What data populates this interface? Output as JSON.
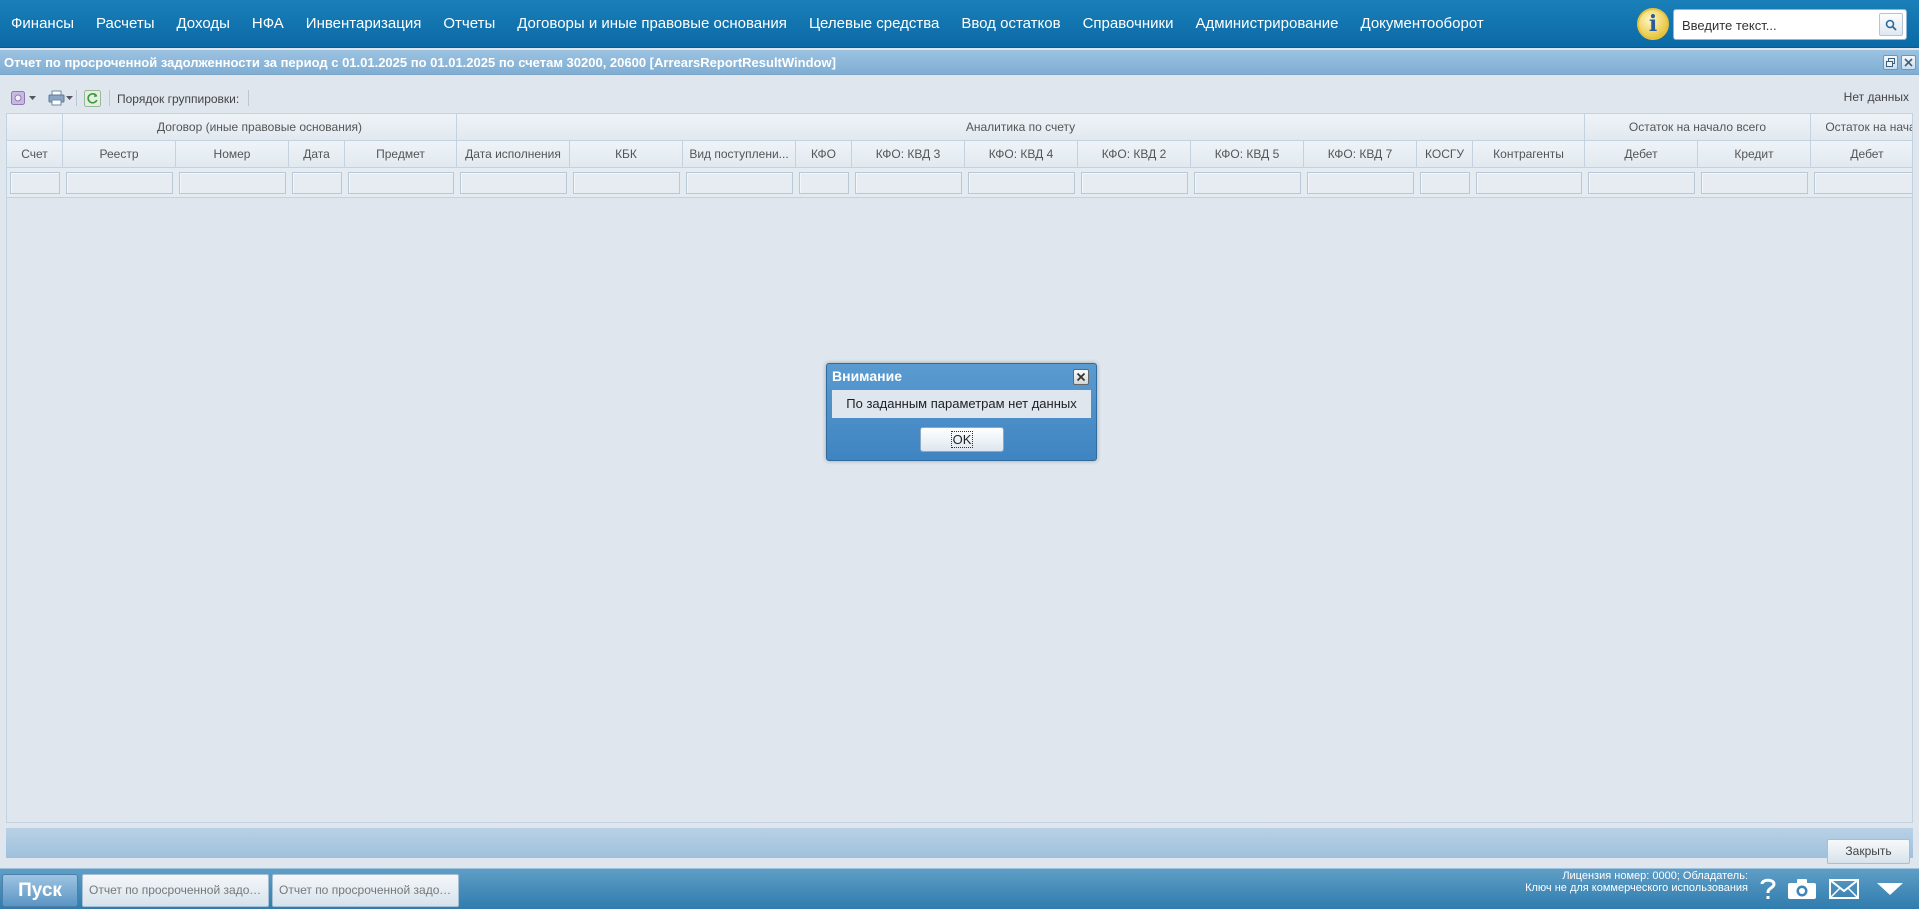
{
  "menu": {
    "items": [
      "Финансы",
      "Расчеты",
      "Доходы",
      "НФА",
      "Инвентаризация",
      "Отчеты",
      "Договоры и иные правовые основания",
      "Целевые средства",
      "Ввод остатков",
      "Справочники",
      "Администрирование",
      "Документооборот"
    ]
  },
  "search": {
    "placeholder": "Введите текст..."
  },
  "window": {
    "title": "Отчет по просроченной задолженности за период с 01.01.2025 по 01.01.2025 по счетам 30200, 20600 [ArrearsReportResultWindow]"
  },
  "toolbar": {
    "grouping_label": "Порядок группировки:",
    "no_data_label": "Нет данных"
  },
  "grid": {
    "group_headers": [
      "Договор (иные правовые основания)",
      "Аналитика по счету",
      "Остаток на начало всего",
      "Остаток на нача"
    ],
    "columns": [
      "Счет",
      "Реестр",
      "Номер",
      "Дата",
      "Предмет",
      "Дата исполнения",
      "КБК",
      "Вид поступлени...",
      "КФО",
      "КФО: КВД 3",
      "КФО: КВД 4",
      "КФО: КВД 2",
      "КФО: КВД 5",
      "КФО: КВД 7",
      "КОСГУ",
      "Контрагенты",
      "Дебет",
      "Кредит",
      "Дебет"
    ]
  },
  "footer": {
    "close_label": "Закрыть"
  },
  "taskbar": {
    "start_label": "Пуск",
    "tasks": [
      "Отчет по просроченной задолженности",
      "Отчет по просроченной задолженности"
    ],
    "license_line1": "Лицензия номер: 0000; Обладатель:",
    "license_line2": "Ключ не для коммерческого использования"
  },
  "dialog": {
    "title": "Внимание",
    "message": "По заданным параметрам нет данных",
    "ok_label": "OK"
  },
  "colors": {
    "menu_bar": "#0b6aa6",
    "window_title_bar": "#7faed4",
    "grid_background": "#dfe6ee",
    "dialog_frame": "#3f84c2",
    "taskbar": "#2f7cae"
  }
}
